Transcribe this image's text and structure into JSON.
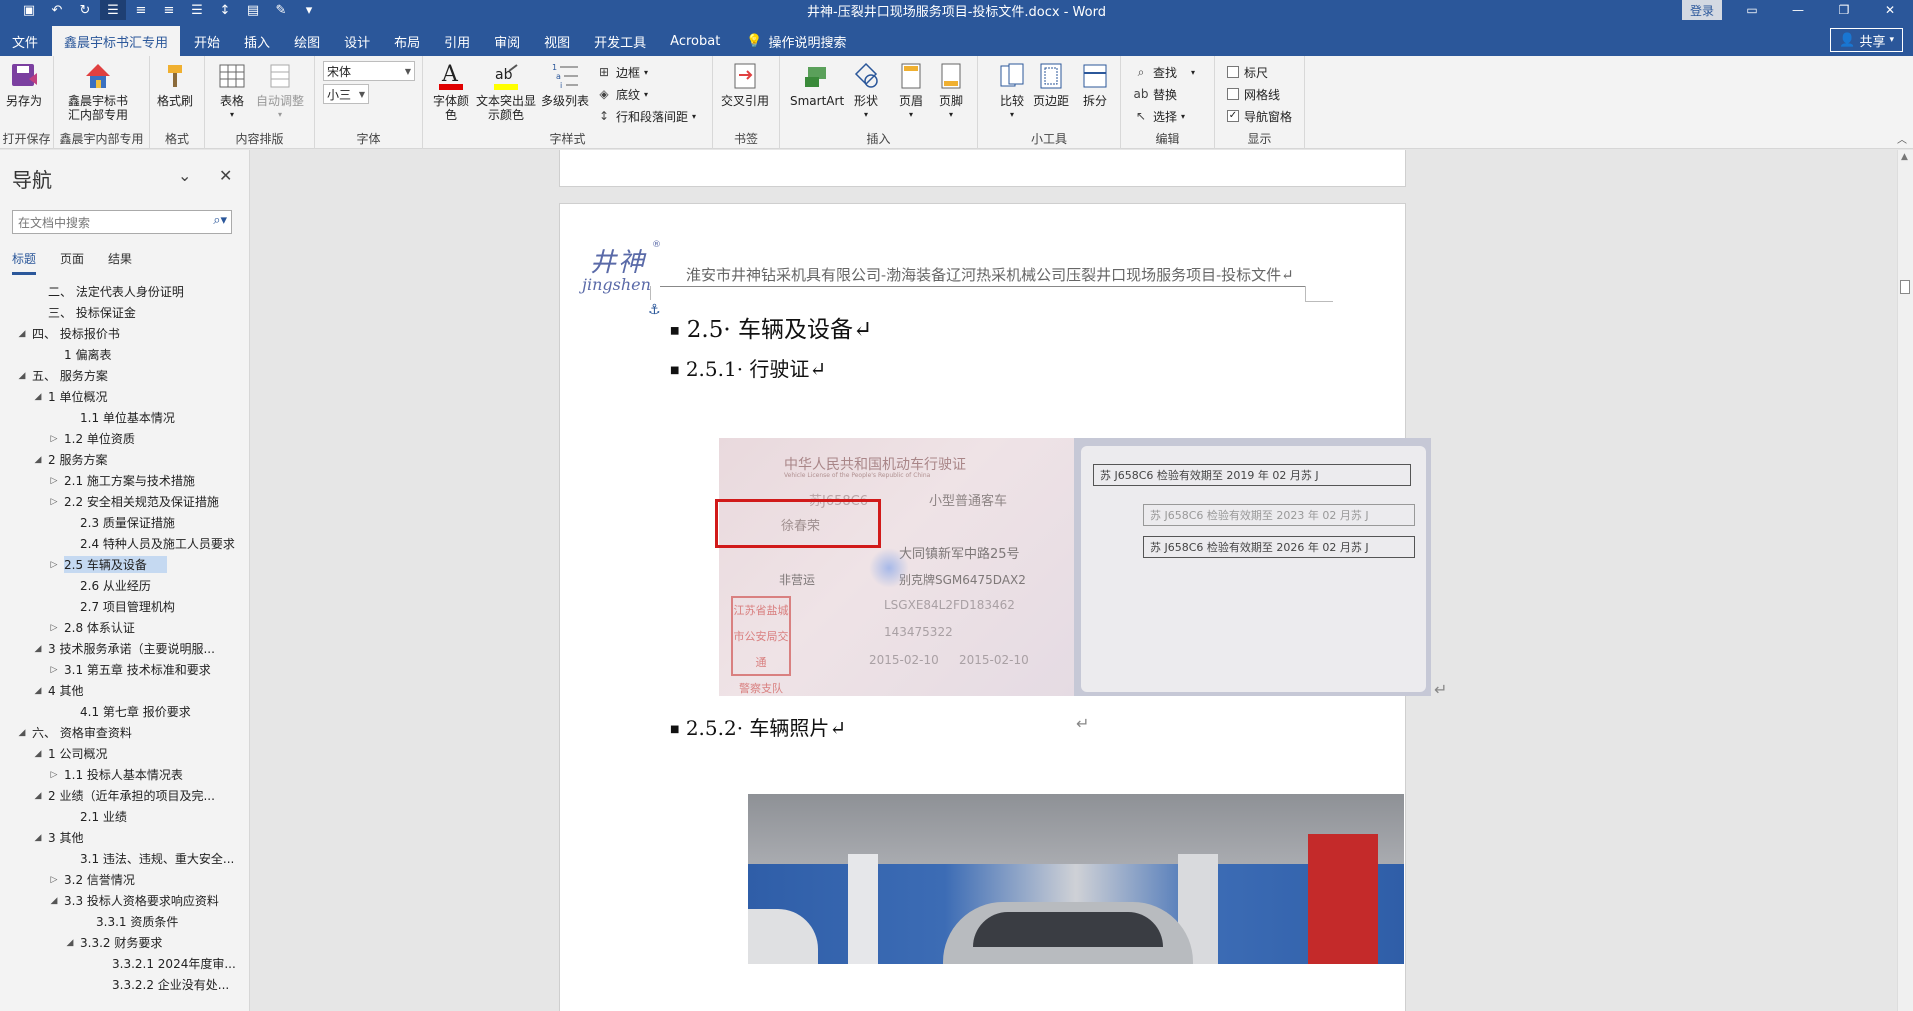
{
  "window": {
    "title": "井神-压裂井口现场服务项目-投标文件.docx - Word",
    "login": "登录",
    "share": "共享"
  },
  "qat_icons": [
    "save-icon",
    "undo-icon",
    "redo-icon",
    "align-left-icon",
    "align-center-icon",
    "align-right-icon",
    "justify-icon",
    "line-spacing-icon",
    "save-as-icon",
    "format-painter-icon",
    "customize-icon"
  ],
  "tabs": [
    "文件",
    "鑫晨宇标书汇专用",
    "开始",
    "插入",
    "绘图",
    "设计",
    "布局",
    "引用",
    "审阅",
    "视图",
    "开发工具",
    "Acrobat"
  ],
  "tell_me": "操作说明搜索",
  "ribbon": {
    "save_as": "另存为",
    "open_save_group": "打开保存",
    "xcy_btn_line1": "鑫晨宇标书",
    "xcy_btn_line2": "汇内部专用",
    "xcy_group": "鑫晨宇内部专用",
    "format_painter": "格式刷",
    "format_group": "格式",
    "table": "表格",
    "autofit": "自动调整",
    "layout_group": "内容排版",
    "font_name": "宋体",
    "font_size": "小三",
    "font_group": "字体",
    "font_color_line1": "字体颜",
    "font_color_line2": "色",
    "highlight_line1": "文本突出显",
    "highlight_line2": "示颜色",
    "multilevel": "多级列表",
    "borders": "边框",
    "shading": "底纹",
    "spacing": "行和段落间距",
    "style_group": "字样式",
    "cross_ref": "交叉引用",
    "bookmark_group": "书签",
    "smartart": "SmartArt",
    "shapes": "形状",
    "header": "页眉",
    "footer": "页脚",
    "insert_group": "插入",
    "compare": "比较",
    "margins": "页边距",
    "split": "拆分",
    "tools_group": "小工具",
    "find": "查找",
    "replace": "替换",
    "select": "选择",
    "edit_group": "编辑",
    "ruler": "标尺",
    "gridlines": "网格线",
    "nav_pane": "导航窗格",
    "show_group": "显示",
    "ruler_checked": false,
    "gridlines_checked": false,
    "nav_pane_checked": true
  },
  "nav": {
    "title": "导航",
    "search_placeholder": "在文档中搜索",
    "tabs": [
      "标题",
      "页面",
      "结果"
    ],
    "items": [
      {
        "label": "二、 法定代表人身份证明",
        "level": 1,
        "arrow": ""
      },
      {
        "label": "三、 投标保证金",
        "level": 1,
        "arrow": ""
      },
      {
        "label": "四、 投标报价书",
        "level": 0,
        "arrow": "◢"
      },
      {
        "label": "1 偏离表",
        "level": 2,
        "arrow": ""
      },
      {
        "label": "五、 服务方案",
        "level": 0,
        "arrow": "◢"
      },
      {
        "label": "1 单位概况",
        "level": 1,
        "arrow": "◢"
      },
      {
        "label": "1.1 单位基本情况",
        "level": 3,
        "arrow": ""
      },
      {
        "label": "1.2 单位资质",
        "level": 2,
        "arrow": "▷"
      },
      {
        "label": "2 服务方案",
        "level": 1,
        "arrow": "◢"
      },
      {
        "label": "2.1 施工方案与技术措施",
        "level": 2,
        "arrow": "▷"
      },
      {
        "label": "2.2 安全相关规范及保证措施",
        "level": 2,
        "arrow": "▷"
      },
      {
        "label": "2.3 质量保证措施",
        "level": 3,
        "arrow": ""
      },
      {
        "label": "2.4 特种人员及施工人员要求",
        "level": 3,
        "arrow": ""
      },
      {
        "label": "2.5 车辆及设备",
        "level": 2,
        "arrow": "▷",
        "selected": true
      },
      {
        "label": "2.6 从业经历",
        "level": 3,
        "arrow": ""
      },
      {
        "label": "2.7 项目管理机构",
        "level": 3,
        "arrow": ""
      },
      {
        "label": "2.8 体系认证",
        "level": 2,
        "arrow": "▷"
      },
      {
        "label": "3 技术服务承诺（主要说明服...",
        "level": 1,
        "arrow": "◢"
      },
      {
        "label": "3.1 第五章 技术标准和要求",
        "level": 2,
        "arrow": "▷"
      },
      {
        "label": "4 其他",
        "level": 1,
        "arrow": "◢"
      },
      {
        "label": "4.1 第七章  报价要求",
        "level": 3,
        "arrow": ""
      },
      {
        "label": "六、 资格审查资料",
        "level": 0,
        "arrow": "◢"
      },
      {
        "label": "1 公司概况",
        "level": 1,
        "arrow": "◢"
      },
      {
        "label": "1.1 投标人基本情况表",
        "level": 2,
        "arrow": "▷"
      },
      {
        "label": "2 业绩（近年承担的项目及完...",
        "level": 1,
        "arrow": "◢"
      },
      {
        "label": "2.1 业绩",
        "level": 3,
        "arrow": ""
      },
      {
        "label": "3 其他",
        "level": 1,
        "arrow": "◢"
      },
      {
        "label": "3.1 违法、违规、重大安全...",
        "level": 3,
        "arrow": ""
      },
      {
        "label": "3.2 信誉情况",
        "level": 2,
        "arrow": "▷"
      },
      {
        "label": "3.3 投标人资格要求响应资料",
        "level": 2,
        "arrow": "◢"
      },
      {
        "label": "3.3.1 资质条件",
        "level": 4,
        "arrow": ""
      },
      {
        "label": "3.3.2 财务要求",
        "level": 3,
        "arrow": "◢"
      },
      {
        "label": "3.3.2.1 2024年度审...",
        "level": 5,
        "arrow": ""
      },
      {
        "label": "3.3.2.2 企业没有处...",
        "level": 5,
        "arrow": ""
      }
    ]
  },
  "doc": {
    "logo_cn": "井神",
    "logo_reg": "®",
    "logo_en": "jingshen",
    "header_text": "淮安市井神钻采机具有限公司-渤海装备辽河热采机械公司压裂井口现场服务项目-投标文件↵",
    "h2_number": "2.5·",
    "h2_text": "车辆及设备↵",
    "h3a_number": "2.5.1·",
    "h3a_text": "行驶证↵",
    "h3b_number": "2.5.2·",
    "h3b_text": "车辆照片↵",
    "para_mark": "↵",
    "license": {
      "title": "中华人民共和国机动车行驶证",
      "subtitle": "Vehicle License of the People's Republic of China",
      "plate": "苏J658C6",
      "vehicle_type": "小型普通客车",
      "owner": "徐春荣",
      "address": "大同镇新军中路25号",
      "use": "非营运",
      "model": "别克牌SGM6475DAX2",
      "vin": "LSGXE84L2FD183462",
      "engine": "143475322",
      "date1": "2015-02-10",
      "date2": "2015-02-10",
      "stamp1": "江苏省盐城",
      "stamp2": "市公安局交通",
      "stamp3": "警察支队",
      "inspect1": "苏 J658C6 检验有效期至 2019 年 02 月苏 J",
      "inspect2": "苏 J658C6 检验有效期至 2023 年 02 月苏 J",
      "inspect3": "苏 J658C6 检验有效期至 2026 年 02 月苏 J"
    }
  }
}
